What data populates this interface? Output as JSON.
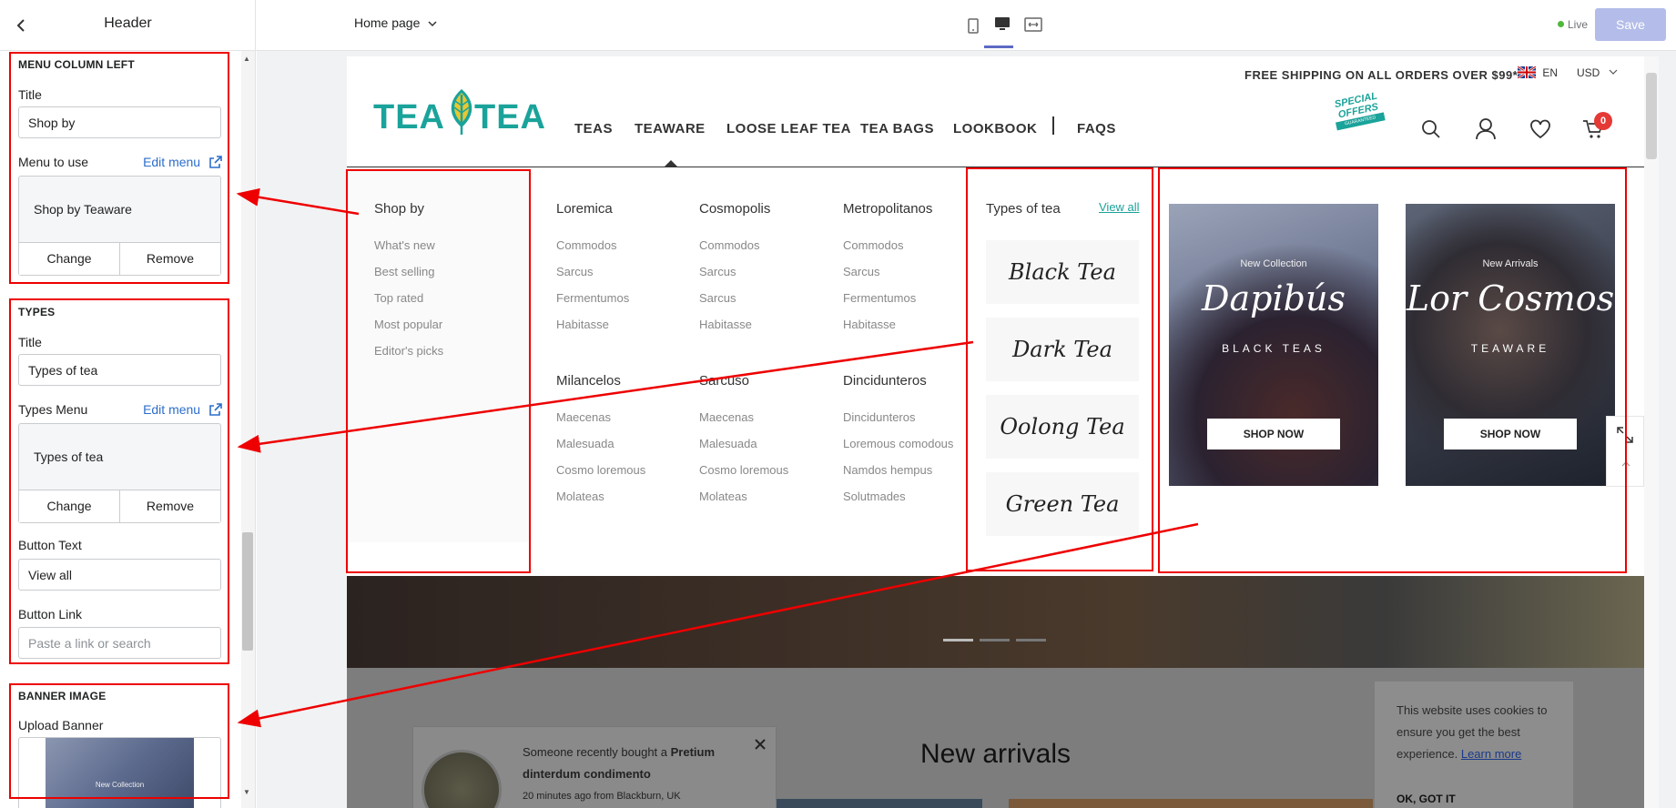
{
  "sidebar": {
    "title": "Header",
    "menu_column_left": {
      "heading": "MENU COLUMN LEFT",
      "title_label": "Title",
      "title_value": "Shop by",
      "menu_label": "Menu to use",
      "edit_menu": "Edit menu",
      "menu_name": "Shop by Teaware",
      "change": "Change",
      "remove": "Remove"
    },
    "types": {
      "heading": "TYPES",
      "title_label": "Title",
      "title_value": "Types of tea",
      "menu_label": "Types Menu",
      "edit_menu": "Edit menu",
      "menu_name": "Types of tea",
      "change": "Change",
      "remove": "Remove",
      "button_text_label": "Button Text",
      "button_text_value": "View all",
      "button_link_label": "Button Link",
      "button_link_placeholder": "Paste a link or search"
    },
    "banner_image": {
      "heading": "BANNER IMAGE",
      "upload_label": "Upload Banner",
      "thumb_text": "New Collection"
    }
  },
  "topbar": {
    "page_selector": "Home page",
    "live": "Live",
    "save": "Save"
  },
  "store": {
    "announcement": "FREE SHIPPING ON ALL ORDERS OVER $99*",
    "language": "EN",
    "currency": "USD",
    "logo_left": "TEA",
    "logo_right": "TEA",
    "nav": [
      "TEAS",
      "TEAWARE",
      "LOOSE LEAF TEA",
      "TEA BAGS",
      "LOOKBOOK",
      "FAQS"
    ],
    "special_offers": [
      "SPECIAL",
      "OFFERS",
      "GUARANTEED"
    ],
    "cart_count": "0"
  },
  "megamenu": {
    "shop_by": {
      "title": "Shop by",
      "links": [
        "What's new",
        "Best selling",
        "Top rated",
        "Most popular",
        "Editor's picks"
      ]
    },
    "columns": [
      {
        "title": "Loremica",
        "links": [
          "Commodos",
          "Sarcus",
          "Fermentumos",
          "Habitasse"
        ]
      },
      {
        "title": "Cosmopolis",
        "links": [
          "Commodos",
          "Sarcus",
          "Sarcus",
          "Habitasse"
        ]
      },
      {
        "title": "Metropolitanos",
        "links": [
          "Commodos",
          "Sarcus",
          "Fermentumos",
          "Habitasse"
        ]
      },
      {
        "title": "Milancelos",
        "links": [
          "Maecenas",
          "Malesuada",
          "Cosmo loremous",
          "Molateas"
        ]
      },
      {
        "title": "Sarcuso",
        "links": [
          "Maecenas",
          "Malesuada",
          "Cosmo loremous",
          "Molateas"
        ]
      },
      {
        "title": "Dincidunteros",
        "links": [
          "Dincidunteros",
          "Loremous comodous",
          "Namdos hempus",
          "Solutmades"
        ]
      }
    ],
    "types": {
      "title": "Types of tea",
      "view_all": "View all",
      "items": [
        "Black Tea",
        "Dark Tea",
        "Oolong Tea",
        "Green Tea"
      ]
    },
    "banners": [
      {
        "small": "New Collection",
        "big": "Dapibús",
        "sub": "BLACK TEAS",
        "button": "SHOP NOW"
      },
      {
        "small": "New Arrivals",
        "big": "Lor Cosmos",
        "sub": "TEAWARE",
        "button": "SHOP NOW"
      }
    ]
  },
  "page": {
    "new_arrivals": "New arrivals",
    "notification": {
      "prefix": "Someone recently bought a",
      "product": "Pretium dinterdum condimento",
      "meta": "20 minutes ago from Blackburn, UK"
    },
    "cookie": {
      "text": "This website uses cookies to ensure you get the best experience.",
      "link": "Learn more",
      "button": "OK, GOT IT"
    }
  },
  "colors": {
    "brand_teal": "#1aa39a",
    "leaf_yellow": "#e8c732",
    "annotation_red": "#e00000",
    "link_blue": "#2c6ecb",
    "save_disabled": "#b4bde9"
  }
}
